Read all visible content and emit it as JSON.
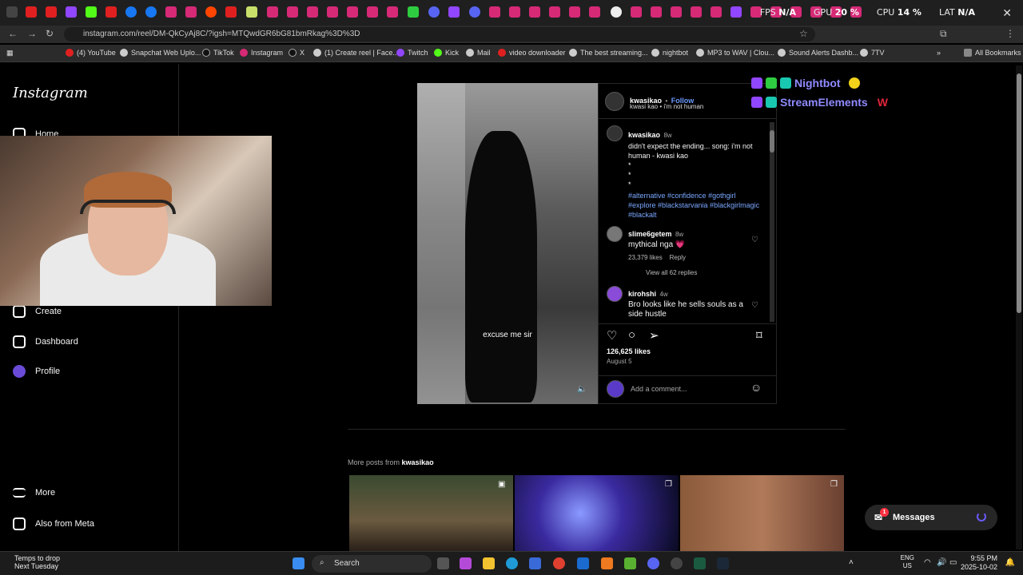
{
  "overlay": {
    "fps_label": "FPS",
    "fps_value": "N/A",
    "gpu_label": "GPU",
    "gpu_value": "20 %",
    "cpu_label": "CPU",
    "cpu_value": "14 %",
    "lat_label": "LAT",
    "lat_value": "N/A"
  },
  "browser": {
    "url": "instagram.com/reel/DM-QkCyAj8C/?igsh=MTQwdGR6bG81bmRkag%3D%3D",
    "bookmarks": [
      "(4) YouTube",
      "Snapchat Web Uplo...",
      "TikTok",
      "Instagram",
      "X",
      "(1) Create reel | Face...",
      "Twitch",
      "Kick",
      "Mail",
      "video downloader",
      "The best streaming...",
      "nightbot",
      "MP3 to WAV | Clou...",
      "Sound Alerts Dashb...",
      "7TV"
    ],
    "all_bookmarks": "All Bookmarks"
  },
  "sidebar": {
    "logo": "Instagram",
    "items": {
      "home": "Home",
      "create": "Create",
      "dashboard": "Dashboard",
      "profile": "Profile",
      "more": "More",
      "meta": "Also from Meta"
    }
  },
  "post": {
    "video_caption": "excuse me sir",
    "author": "kwasikao",
    "follow": "Follow",
    "separator": "•",
    "subtitle": "kwasi kao • i'm not human",
    "caption_time": "8w",
    "caption": "didn't expect the ending... song: i'm not human - kwasi kao",
    "dots": [
      "*",
      "*",
      "*"
    ],
    "hashtags": "#alternative #confidence #gothgirl #explore #blackstarvania #blackgirlmagic #blackalt",
    "comments": [
      {
        "user": "slime6getem",
        "time": "8w",
        "text": "mythical nga 💗",
        "likes": "23,379 likes",
        "reply": "Reply",
        "view_replies": "View all 62 replies"
      },
      {
        "user": "kirohshi",
        "time": "4w",
        "text": "Bro looks like he sells souls as a side hustle"
      }
    ],
    "likes": "126,625 likes",
    "date": "August 5",
    "add_comment": "Add a comment..."
  },
  "stream_overlay": {
    "nightbot": "Nightbot",
    "streamelements": "StreamElements",
    "w": "W"
  },
  "more_posts": {
    "label": "More posts from",
    "author": "kwasikao"
  },
  "messages": {
    "label": "Messages",
    "badge": "1"
  },
  "taskbar": {
    "weather_title": "Temps to drop",
    "weather_sub": "Next Tuesday",
    "search": "Search",
    "lang1": "ENG",
    "lang2": "US",
    "time": "9:55 PM",
    "date": "2025-10-02"
  }
}
